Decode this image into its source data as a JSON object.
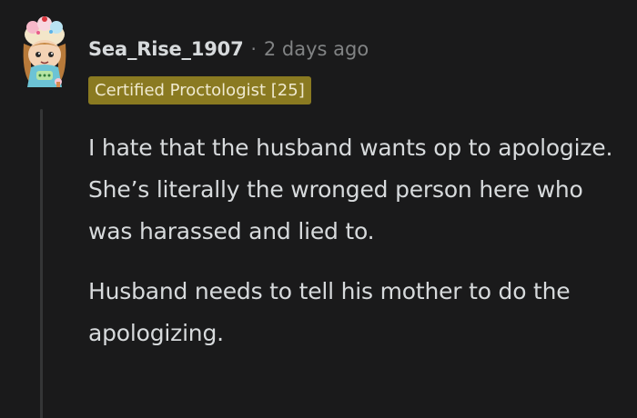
{
  "comment": {
    "author": "Sea_Rise_1907",
    "separator": "·",
    "timestamp": "2 days ago",
    "flair": "Certified Proctologist [25]",
    "paragraphs": [
      "I hate that the husband wants op to apologize. She’s literally the wronged person here who was harassed and lied to.",
      "Husband needs to tell his mother to do the apologizing."
    ],
    "avatar_icon": "snoo-avatar-with-cupcake-hat"
  },
  "colors": {
    "background": "#1a1a1b",
    "text": "#d7dadc",
    "meta": "#818384",
    "flair_bg": "#8a7a21",
    "flair_text": "#f0ead0",
    "thread_line": "#343536"
  }
}
